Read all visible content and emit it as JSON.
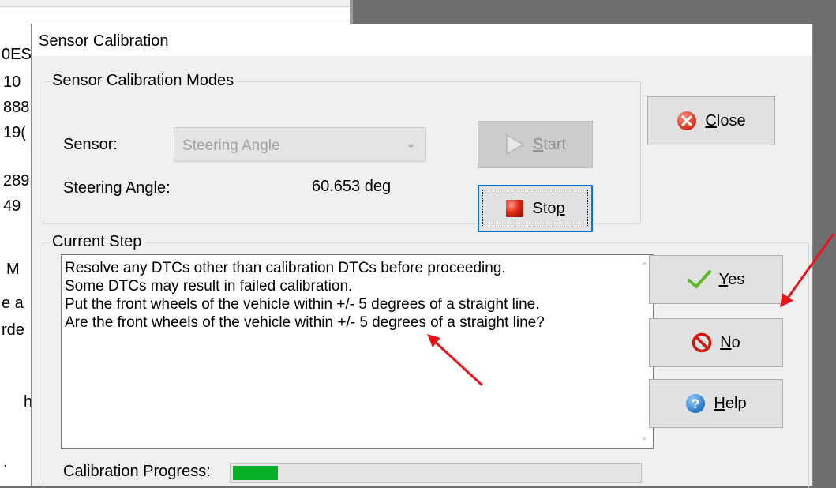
{
  "background_window": {
    "fragments": [
      "0ES",
      "10",
      "888",
      "19(",
      "289",
      "49",
      "M",
      "e a",
      "rde",
      "h",
      "."
    ]
  },
  "dialog": {
    "title": "Sensor Calibration",
    "modes_group": {
      "legend": "Sensor Calibration Modes",
      "sensor_label": "Sensor:",
      "sensor_value": "Steering Angle",
      "angle_label": "Steering Angle:",
      "angle_value": "60.653 deg",
      "start_button": {
        "label": "Start",
        "mnemonic": "S",
        "rest": "tart"
      },
      "stop_button": {
        "label": "Stop",
        "prefix": "Sto",
        "mnemonic": "p"
      }
    },
    "close_button": {
      "label": "Close",
      "mnemonic": "C",
      "rest": "lose"
    },
    "step_group": {
      "legend": "Current Step",
      "lines": [
        "Resolve any DTCs other than calibration DTCs before proceeding.",
        "Some DTCs may result in failed calibration.",
        "Put the front wheels of the vehicle within +/- 5 degrees of a straight line.",
        "Are the front wheels of the vehicle within +/- 5 degrees of a straight line?"
      ],
      "progress_label": "Calibration Progress:",
      "progress_fraction": 0.11
    },
    "yes_button": {
      "label": "Yes",
      "mnemonic": "Y",
      "rest": "es"
    },
    "no_button": {
      "label": "No",
      "mnemonic": "N",
      "rest": "o"
    },
    "help_button": {
      "label": "Help",
      "mnemonic": "H",
      "rest": "elp"
    }
  },
  "colors": {
    "annotation_arrow": "#e8141b",
    "progress_fill": "#06b025",
    "focus_border": "#0078d7"
  }
}
